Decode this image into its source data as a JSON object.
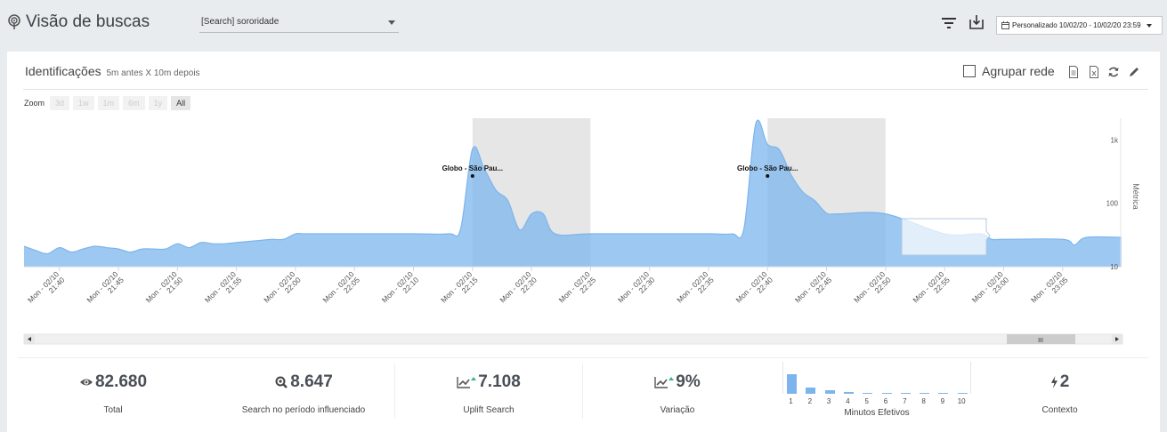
{
  "header": {
    "title": "Visão de buscas",
    "search_value": "[Search] sororidade",
    "date_range": "Personalizado 10/02/20 - 10/02/20 23:59"
  },
  "card": {
    "title": "Identificações",
    "subtitle": "5m antes X 10m depois",
    "agrupar_label": "Agrupar rede"
  },
  "zoom": {
    "label": "Zoom",
    "buttons": [
      "3d",
      "1w",
      "1m",
      "6m",
      "1y",
      "All"
    ],
    "active": "All"
  },
  "chart_data": {
    "type": "area",
    "y_axis_title": "Métrica",
    "y_scale": "log",
    "y_ticks": [
      "1k",
      "100",
      "10"
    ],
    "x_ticks": [
      "Mon - 02/10 21:40",
      "Mon - 02/10 21:45",
      "Mon - 02/10 21:50",
      "Mon - 02/10 21:55",
      "Mon - 02/10 22:00",
      "Mon - 02/10 22:05",
      "Mon - 02/10 22:10",
      "Mon - 02/10 22:15",
      "Mon - 02/10 22:20",
      "Mon - 02/10 22:25",
      "Mon - 02/10 22:30",
      "Mon - 02/10 22:35",
      "Mon - 02/10 22:40",
      "Mon - 02/10 22:45",
      "Mon - 02/10 22:50",
      "Mon - 02/10 22:55",
      "Mon - 02/10 23:00",
      "Mon - 02/10 23:05"
    ],
    "x_start": "21:37",
    "x_end": "23:10",
    "series": [
      {
        "color": "#7cb5ec",
        "points": [
          [
            "21:37",
            21
          ],
          [
            "21:38",
            18
          ],
          [
            "21:39",
            16
          ],
          [
            "21:40",
            20
          ],
          [
            "21:41",
            17
          ],
          [
            "21:42",
            19
          ],
          [
            "21:43",
            21
          ],
          [
            "21:44",
            20
          ],
          [
            "21:45",
            19
          ],
          [
            "21:46",
            17
          ],
          [
            "21:47",
            19
          ],
          [
            "21:48",
            19
          ],
          [
            "21:49",
            19
          ],
          [
            "21:50",
            23
          ],
          [
            "21:51",
            20
          ],
          [
            "21:52",
            24
          ],
          [
            "21:53",
            23
          ],
          [
            "21:54",
            23
          ],
          [
            "21:55",
            24
          ],
          [
            "21:56",
            25
          ],
          [
            "21:57",
            26
          ],
          [
            "21:58",
            27
          ],
          [
            "21:59",
            27
          ],
          [
            "22:00",
            33
          ],
          [
            "22:01",
            33
          ],
          [
            "22:05",
            33
          ],
          [
            "22:10",
            33
          ],
          [
            "22:13",
            33
          ],
          [
            "22:14",
            40
          ],
          [
            "22:15",
            720
          ],
          [
            "22:16",
            350
          ],
          [
            "22:17",
            160
          ],
          [
            "22:18",
            110
          ],
          [
            "22:19",
            38
          ],
          [
            "22:20",
            68
          ],
          [
            "22:21",
            68
          ],
          [
            "22:22",
            33
          ],
          [
            "22:25",
            33
          ],
          [
            "22:30",
            33
          ],
          [
            "22:35",
            33
          ],
          [
            "22:37",
            33
          ],
          [
            "22:38",
            40
          ],
          [
            "22:39",
            1800
          ],
          [
            "22:40",
            850
          ],
          [
            "22:41",
            700
          ],
          [
            "22:42",
            280
          ],
          [
            "22:43",
            150
          ],
          [
            "22:44",
            110
          ],
          [
            "22:45",
            70
          ],
          [
            "22:46",
            68
          ],
          [
            "22:50",
            68
          ],
          [
            "22:55",
            33
          ],
          [
            "22:58",
            33
          ],
          [
            "22:59",
            27
          ],
          [
            "23:00",
            27
          ],
          [
            "23:05",
            27
          ],
          [
            "23:06",
            22
          ],
          [
            "23:07",
            29
          ],
          [
            "23:10",
            29
          ]
        ]
      }
    ],
    "highlight_bands": [
      [
        "22:15",
        "22:25"
      ],
      [
        "22:40",
        "22:50"
      ]
    ],
    "annotations": [
      {
        "x": "22:15",
        "y": 270,
        "label": "Globo - São Pau..."
      },
      {
        "x": "22:40",
        "y": 270,
        "label": "Globo - São Pau..."
      }
    ],
    "scroll_grip": "III"
  },
  "stats": [
    {
      "value": "82.680",
      "label": "Total",
      "icon": "eye-icon"
    },
    {
      "value": "8.647",
      "label": "Search no período influenciado",
      "icon": "search-zoom-icon"
    },
    {
      "value": "7.108",
      "label": "Uplift Search",
      "icon": "trend-up-icon"
    },
    {
      "value": "9%",
      "label": "Variação",
      "icon": "trend-up-icon"
    },
    {
      "value": "2",
      "label": "Contexto",
      "icon": "bolt-icon"
    }
  ],
  "histogram": {
    "caption": "Minutos Efetivos",
    "labels": [
      "1",
      "2",
      "3",
      "4",
      "5",
      "6",
      "7",
      "8",
      "9",
      "10"
    ],
    "values": [
      100,
      30,
      20,
      8,
      5,
      4,
      3,
      2,
      1,
      1
    ]
  },
  "colors": {
    "series": "#7cb5ec",
    "band": "#e6e6e6",
    "accent_green": "#3bb38a"
  }
}
